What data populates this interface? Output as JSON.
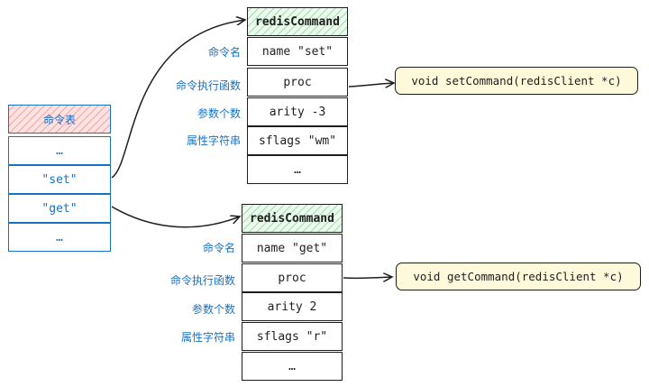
{
  "command_table": {
    "header": "命令表",
    "rows": [
      "…",
      "\"set\"",
      "\"get\"",
      "…"
    ]
  },
  "set_command": {
    "header": "redisCommand",
    "fields": [
      "name \"set\"",
      "proc",
      "arity -3",
      "sflags \"wm\"",
      "…"
    ],
    "labels": [
      "命令名",
      "命令执行函数",
      "参数个数",
      "属性字符串"
    ],
    "function": "void setCommand(redisClient *c)"
  },
  "get_command": {
    "header": "redisCommand",
    "fields": [
      "name \"get\"",
      "proc",
      "arity 2",
      "sflags \"r\"",
      "…"
    ],
    "labels": [
      "命令名",
      "命令执行函数",
      "参数个数",
      "属性字符串"
    ],
    "function": "void getCommand(redisClient *c)"
  }
}
